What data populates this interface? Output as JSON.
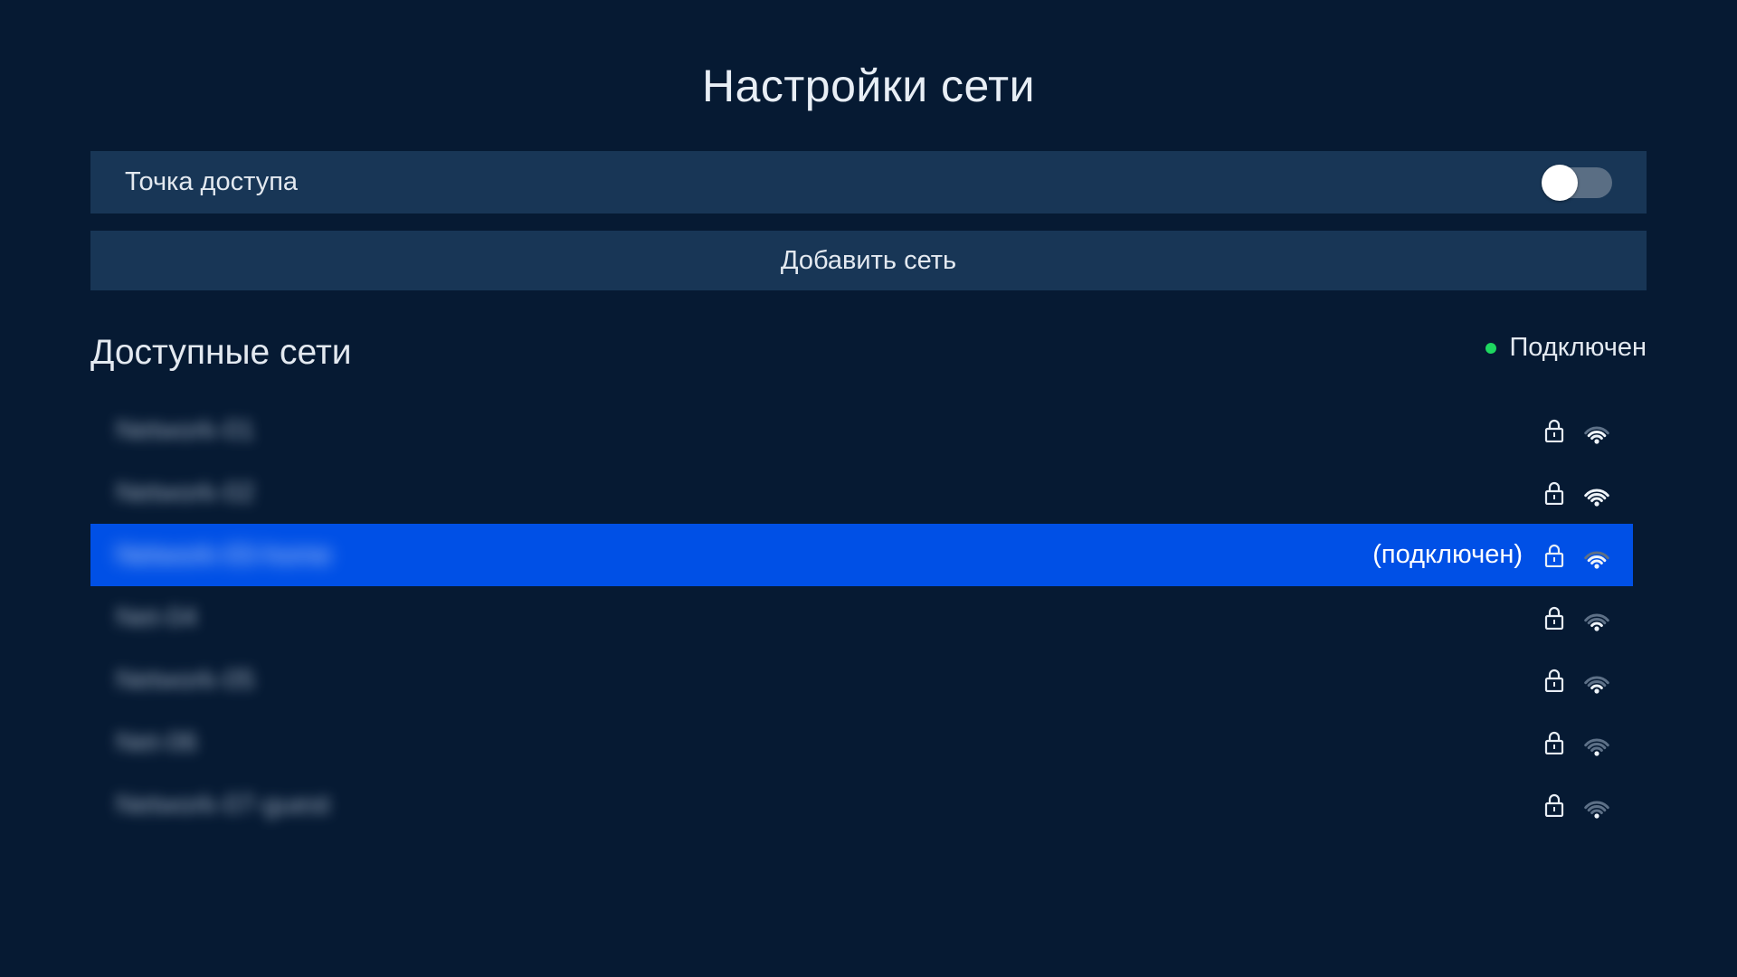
{
  "page": {
    "title": "Настройки сети"
  },
  "hotspot": {
    "label": "Точка доступа",
    "enabled": false
  },
  "add_network": {
    "label": "Добавить сеть"
  },
  "networks_section": {
    "title": "Доступные сети",
    "legend_label": "Подключен",
    "legend_color": "#1ed760"
  },
  "networks": [
    {
      "ssid": "Network-01",
      "secured": true,
      "signal": 3,
      "connected": false,
      "status": ""
    },
    {
      "ssid": "Network-02",
      "secured": true,
      "signal": 4,
      "connected": false,
      "status": ""
    },
    {
      "ssid": "Network-03-home",
      "secured": true,
      "signal": 3,
      "connected": true,
      "status": "(подключен)"
    },
    {
      "ssid": "Net-04",
      "secured": true,
      "signal": 2,
      "connected": false,
      "status": ""
    },
    {
      "ssid": "Network-05",
      "secured": true,
      "signal": 2,
      "connected": false,
      "status": ""
    },
    {
      "ssid": "Net-06",
      "secured": true,
      "signal": 1,
      "connected": false,
      "status": ""
    },
    {
      "ssid": "Network-07-guest",
      "secured": true,
      "signal": 1,
      "connected": false,
      "status": ""
    }
  ],
  "colors": {
    "background": "#061a33",
    "panel": "#183656",
    "selected_row": "#0050e6"
  }
}
